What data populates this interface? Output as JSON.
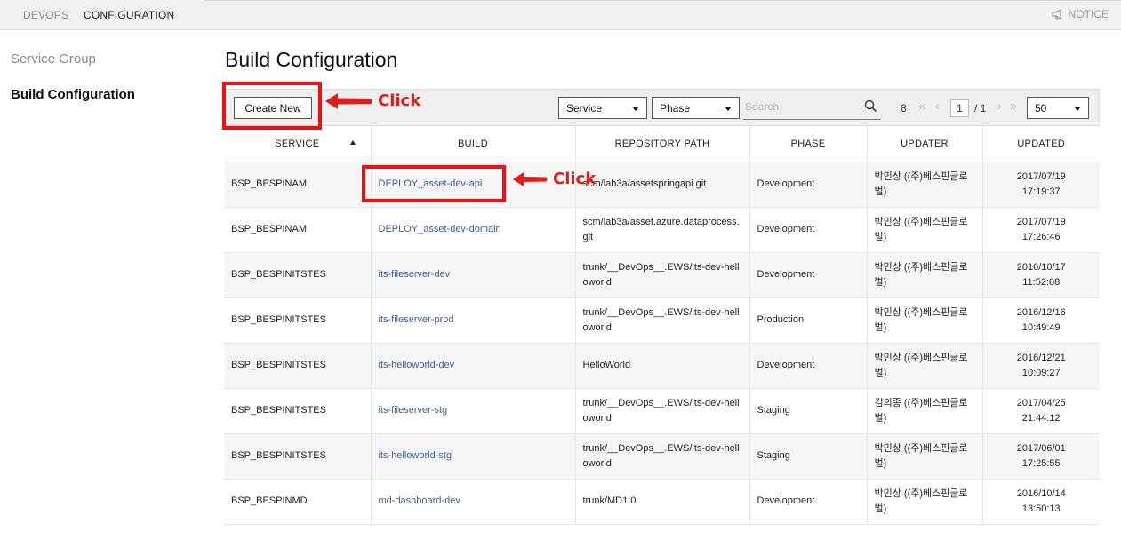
{
  "topnav": {
    "tabs": [
      {
        "label": "DEVOPS"
      },
      {
        "label": "CONFIGURATION"
      }
    ],
    "notice_label": "NOTICE"
  },
  "sidebar": {
    "items": [
      {
        "label": "Service Group",
        "active": false
      },
      {
        "label": "Build Configuration",
        "active": true
      }
    ]
  },
  "page": {
    "title": "Build Configuration"
  },
  "toolbar": {
    "create_label": "Create New",
    "service_select": "Service",
    "phase_select": "Phase",
    "search_placeholder": "Search",
    "total_count": "8",
    "page_current": "1",
    "page_total": "/ 1",
    "page_size": "50"
  },
  "table": {
    "headers": [
      "SERVICE",
      "BUILD",
      "REPOSITORY PATH",
      "PHASE",
      "UPDATER",
      "UPDATED"
    ],
    "rows": [
      {
        "service": "BSP_BESPINAM",
        "build": "DEPLOY_asset-dev-api",
        "repo": "scm/lab3a/assetspringapi.git",
        "phase": "Development",
        "updater": "박민상 ((주)베스핀글로벌)",
        "updated_date": "2017/07/19",
        "updated_time": "17:19:37"
      },
      {
        "service": "BSP_BESPINAM",
        "build": "DEPLOY_asset-dev-domain",
        "repo": "scm/lab3a/asset.azure.dataprocess.git",
        "phase": "Development",
        "updater": "박민상 ((주)베스핀글로벌)",
        "updated_date": "2017/07/19",
        "updated_time": "17:26:46"
      },
      {
        "service": "BSP_BESPINITSTES",
        "build": "its-fileserver-dev",
        "repo": "trunk/__DevOps__.EWS/its-dev-helloworld",
        "phase": "Development",
        "updater": "박민상 ((주)베스핀글로벌)",
        "updated_date": "2016/10/17",
        "updated_time": "11:52:08"
      },
      {
        "service": "BSP_BESPINITSTES",
        "build": "its-fileserver-prod",
        "repo": "trunk/__DevOps__.EWS/its-dev-helloworld",
        "phase": "Production",
        "updater": "박민상 ((주)베스핀글로벌)",
        "updated_date": "2016/12/16",
        "updated_time": "10:49:49"
      },
      {
        "service": "BSP_BESPINITSTES",
        "build": "its-helloworld-dev",
        "repo": "HelloWorld",
        "phase": "Development",
        "updater": "박민상 ((주)베스핀글로벌)",
        "updated_date": "2016/12/21",
        "updated_time": "10:09:27"
      },
      {
        "service": "BSP_BESPINITSTES",
        "build": "its-fileserver-stg",
        "repo": "trunk/__DevOps__.EWS/its-dev-helloworld",
        "phase": "Staging",
        "updater": "김의종 ((주)베스핀글로벌)",
        "updated_date": "2017/04/25",
        "updated_time": "21:44:12"
      },
      {
        "service": "BSP_BESPINITSTES",
        "build": "its-helloworld-stg",
        "repo": "trunk/__DevOps__.EWS/its-dev-helloworld",
        "phase": "Staging",
        "updater": "박민상 ((주)베스핀글로벌)",
        "updated_date": "2017/06/01",
        "updated_time": "17:25:55"
      },
      {
        "service": "BSP_BESPINMD",
        "build": "md-dashboard-dev",
        "repo": "trunk/MD1.0",
        "phase": "Development",
        "updater": "박민상 ((주)베스핀글로벌)",
        "updated_date": "2016/10/14",
        "updated_time": "13:50:13"
      }
    ]
  },
  "annotations": {
    "click_label_1": "Click",
    "click_label_2": "Click",
    "highlight_color": "#ee1111"
  },
  "colors": {
    "link": "#3f5f9c",
    "toolbar_bg": "#efefef",
    "topbar_bg": "#f1f1f1"
  }
}
